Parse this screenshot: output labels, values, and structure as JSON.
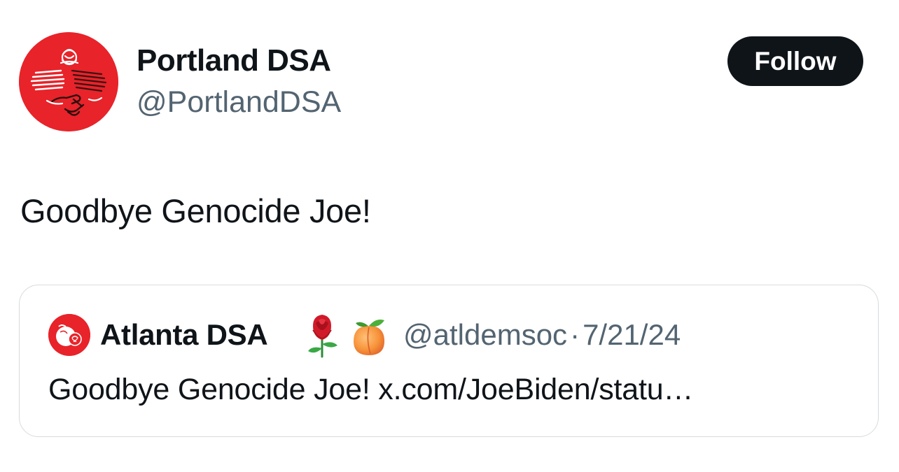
{
  "author": {
    "display_name": "Portland DSA",
    "handle": "@PortlandDSA",
    "avatar_icon": "dsa-rose-handshake-logo",
    "avatar_color": "#e8232a"
  },
  "follow_button": {
    "label": "Follow"
  },
  "tweet": {
    "text": "Goodbye Genocide Joe!"
  },
  "quoted_tweet": {
    "display_name": "Atlanta DSA",
    "emoji": [
      "rose-icon",
      "peach-icon"
    ],
    "handle": "@atldemsoc",
    "separator": "·",
    "date": "7/21/24",
    "text": "Goodbye Genocide Joe! x.com/JoeBiden/statu…",
    "avatar_icon": "atlanta-dsa-peach-rose-logo"
  },
  "colors": {
    "text_primary": "#0f1419",
    "text_secondary": "#536471",
    "button_bg": "#0f1419",
    "card_border": "#d6dbdf",
    "brand_red": "#e8232a"
  }
}
